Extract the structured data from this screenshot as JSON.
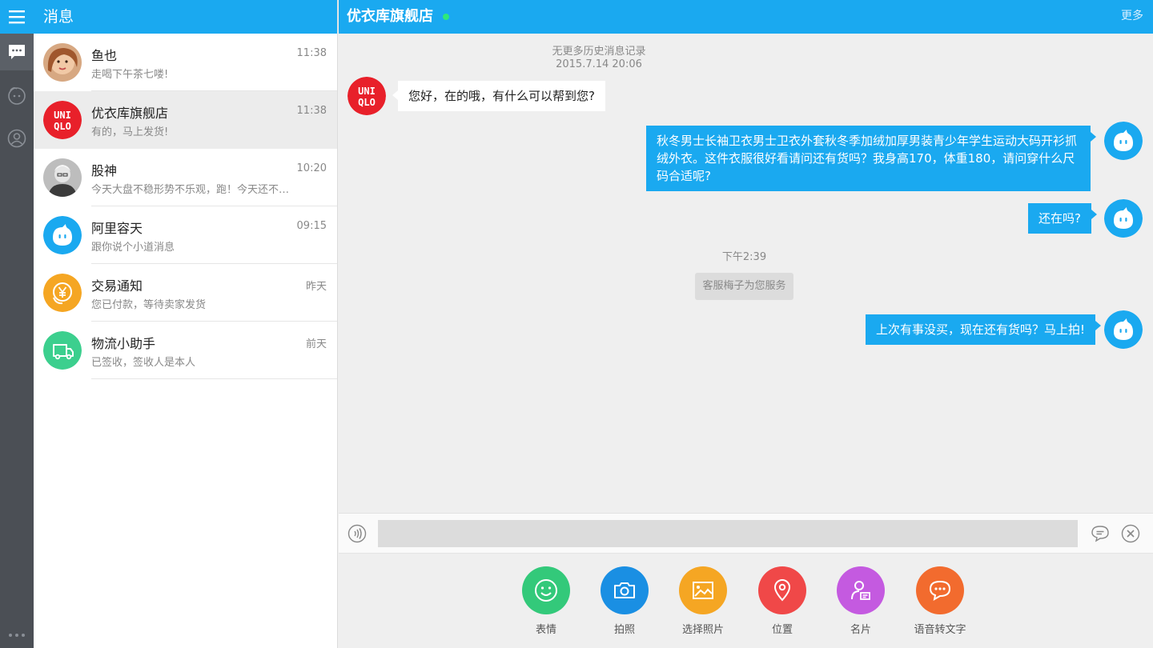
{
  "nav": {
    "title": "消息"
  },
  "conversations": [
    {
      "name": "鱼也",
      "preview": "走喝下午茶七喽!",
      "time": "11:38",
      "avatar": "photo-woman"
    },
    {
      "name": "优衣库旗舰店",
      "preview": "有的，马上发货!",
      "time": "11:38",
      "avatar": "uniqlo-logo"
    },
    {
      "name": "股神",
      "preview": "今天大盘不稳形势不乐观，跑！今天还不跑就来不及了",
      "time": "10:20",
      "avatar": "photo-man"
    },
    {
      "name": "阿里容天",
      "preview": "跟你说个小道消息",
      "time": "09:15",
      "avatar": "mascot"
    },
    {
      "name": "交易通知",
      "preview": "您已付款，等待卖家发货",
      "time": "昨天",
      "avatar": "yen-icon"
    },
    {
      "name": "物流小助手",
      "preview": "已签收，签收人是本人",
      "time": "前天",
      "avatar": "truck-icon"
    }
  ],
  "chat": {
    "title": "优衣库旗舰店",
    "more": "更多",
    "history_note": "无更多历史消息记录",
    "history_time": "2015.7.14 20:06",
    "messages": [
      {
        "text": "您好，在的哦，有什么可以帮到您?"
      },
      {
        "text": "秋冬男士长袖卫衣男士卫衣外套秋冬季加绒加厚男装青少年学生运动大码开衫抓绒外衣。这件衣服很好看请问还有货吗？我身高170，体重180，请问穿什么尺码合适呢?"
      },
      {
        "text": "还在吗?"
      },
      {
        "text": "上次有事没买，现在还有货吗？马上拍!"
      }
    ],
    "time_divider": "下午2:39",
    "service_note": "客服梅子为您服务",
    "input_value": ""
  },
  "tools": [
    {
      "label": "表情",
      "icon": "smile-icon",
      "color": "#33c97a"
    },
    {
      "label": "拍照",
      "icon": "camera-icon",
      "color": "#1a8fe3"
    },
    {
      "label": "选择照片",
      "icon": "photo-icon",
      "color": "#f5a623"
    },
    {
      "label": "位置",
      "icon": "location-icon",
      "color": "#f04848"
    },
    {
      "label": "名片",
      "icon": "contact-card-icon",
      "color": "#c45ae0"
    },
    {
      "label": "语音转文字",
      "icon": "voice-to-text-icon",
      "color": "#f26b2e"
    }
  ],
  "colors": {
    "brand": "#1aa9f0",
    "rail": "#4b4f55",
    "uniqlo": "#e8202a"
  }
}
